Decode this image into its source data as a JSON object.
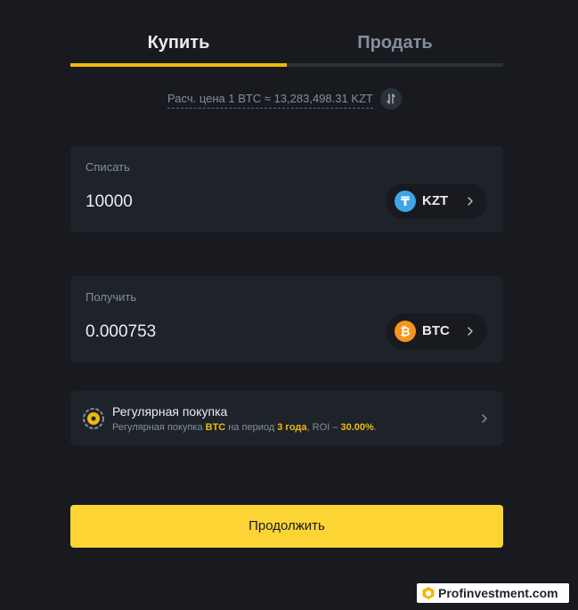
{
  "tabs": {
    "buy_label": "Купить",
    "sell_label": "Продать",
    "active": "buy"
  },
  "rate": {
    "text": "Расч. цена 1 BTC ≈ 13,283,498.31 KZT",
    "icon": "swap-icon"
  },
  "spend": {
    "label": "Списать",
    "value": "10000",
    "currency": "KZT",
    "currency_icon": "tenge-icon",
    "currency_icon_glyph": "₸"
  },
  "receive": {
    "label": "Получить",
    "value": "0.000753",
    "currency": "BTC",
    "currency_icon": "bitcoin-icon",
    "currency_icon_glyph": "₿"
  },
  "recurring": {
    "title": "Регулярная покупка",
    "sub_prefix": "Регулярная покупка ",
    "coin": "BTC",
    "sub_mid": " на период ",
    "period": "3 года",
    "sub_roi": ", ROI – ",
    "roi": "30.00%",
    "sub_end": "."
  },
  "continue_label": "Продолжить",
  "watermark": {
    "text": "Profinvestment.com"
  },
  "colors": {
    "background": "#181a20",
    "card": "#1e2329",
    "accent": "#f0b90b",
    "button": "#fcd535",
    "muted_text": "#848e9c"
  }
}
